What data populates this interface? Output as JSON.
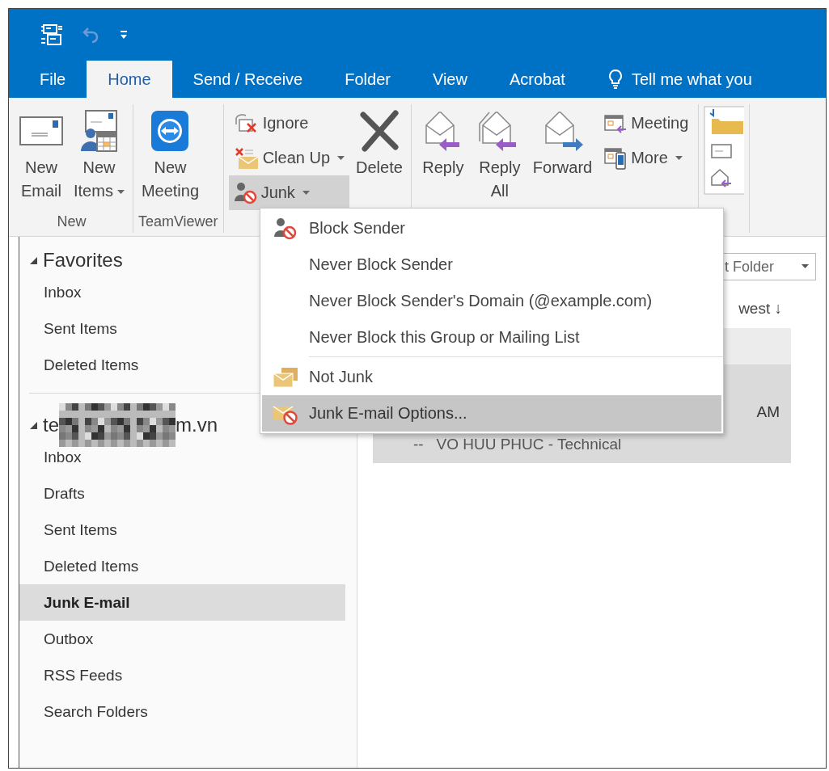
{
  "tabs": [
    {
      "label": "File",
      "selected": false
    },
    {
      "label": "Home",
      "selected": true
    },
    {
      "label": "Send / Receive",
      "selected": false
    },
    {
      "label": "Folder",
      "selected": false
    },
    {
      "label": "View",
      "selected": false
    },
    {
      "label": "Acrobat",
      "selected": false
    }
  ],
  "tell_me": "Tell me what you",
  "ribbon": {
    "groups": [
      {
        "label": "New",
        "commands": [
          {
            "kind": "large",
            "lines": [
              "New",
              "Email"
            ],
            "dropdown": false,
            "pressed": false
          },
          {
            "kind": "large",
            "lines": [
              "New",
              "Items"
            ],
            "dropdown": true,
            "pressed": false
          }
        ]
      },
      {
        "label": "TeamViewer",
        "commands": [
          {
            "kind": "large",
            "lines": [
              "New",
              "Meeting"
            ],
            "dropdown": false,
            "pressed": false
          }
        ]
      },
      {
        "commands": [
          {
            "kind": "small",
            "lines": [
              "Ignore"
            ],
            "dropdown": false,
            "pressed": false
          },
          {
            "kind": "small",
            "lines": [
              "Clean Up"
            ],
            "dropdown": true,
            "pressed": false
          },
          {
            "kind": "small",
            "lines": [
              "Junk"
            ],
            "dropdown": true,
            "pressed": true
          },
          {
            "kind": "large",
            "lines": [
              "Delete"
            ],
            "dropdown": false,
            "pressed": false
          }
        ]
      },
      {
        "commands": [
          {
            "kind": "large",
            "lines": [
              "Reply"
            ],
            "dropdown": false,
            "pressed": false
          },
          {
            "kind": "large",
            "lines": [
              "Reply",
              "All"
            ],
            "dropdown": false,
            "pressed": false
          },
          {
            "kind": "large",
            "lines": [
              "Forward"
            ],
            "dropdown": false,
            "pressed": false
          },
          {
            "kind": "small",
            "lines": [
              "Meeting"
            ],
            "dropdown": false,
            "pressed": false
          },
          {
            "kind": "small",
            "lines": [
              "More"
            ],
            "dropdown": true,
            "pressed": false
          }
        ]
      },
      {
        "commands": [
          {
            "kind": "gallery"
          }
        ]
      }
    ]
  },
  "junk_menu": {
    "items": [
      {
        "kind": "item",
        "label": "Block Sender",
        "selected": false
      },
      {
        "kind": "item",
        "label": "Never Block Sender",
        "selected": false
      },
      {
        "kind": "item",
        "label": "Never Block Sender's Domain (@example.com)",
        "selected": false
      },
      {
        "kind": "item",
        "label": "Never Block this Group or Mailing List",
        "selected": false
      },
      {
        "kind": "separator"
      },
      {
        "kind": "item",
        "label": "Not Junk",
        "selected": false
      },
      {
        "kind": "item",
        "label": "Junk E-mail Options...",
        "selected": true
      }
    ]
  },
  "nav": {
    "sections": [
      {
        "title": "Favorites",
        "expanded": true,
        "children": [
          {
            "label": "Inbox",
            "selected": false
          },
          {
            "label": "Sent Items",
            "selected": false
          },
          {
            "label": "Deleted Items",
            "selected": false
          }
        ]
      },
      {
        "title": "te",
        "title_end": "m.vn",
        "redacted": true,
        "expanded": true,
        "children": [
          {
            "label": "Inbox",
            "selected": false
          },
          {
            "label": "Drafts",
            "selected": false
          },
          {
            "label": "Sent Items",
            "selected": false
          },
          {
            "label": "Deleted Items",
            "selected": false
          },
          {
            "label": "Junk E-mail",
            "selected": true
          },
          {
            "label": "Outbox",
            "selected": false
          },
          {
            "label": "RSS Feeds",
            "selected": false
          },
          {
            "label": "Search Folders",
            "selected": false
          }
        ]
      }
    ]
  },
  "mail": {
    "scope_dropdown": "t Folder",
    "sort": "west ↓",
    "message": {
      "time": "AM",
      "preview": "--   VO HUU PHUC - Technical"
    }
  }
}
